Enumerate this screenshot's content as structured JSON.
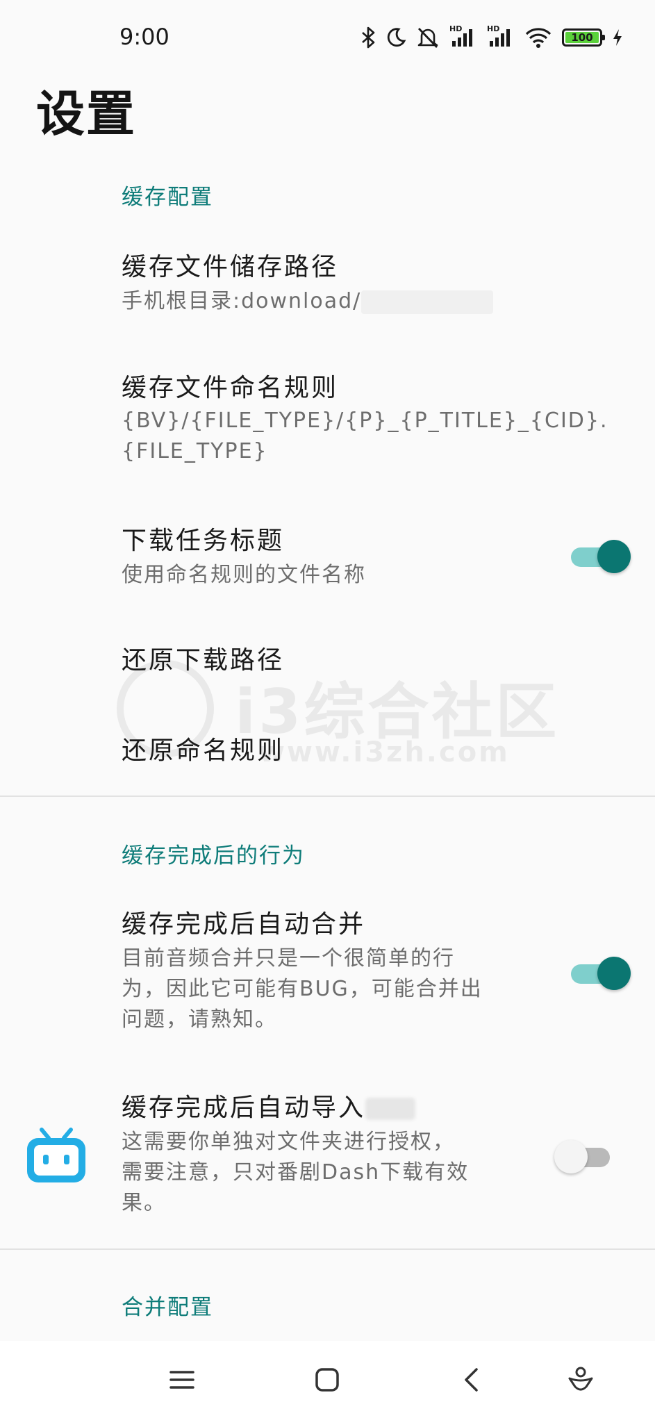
{
  "status_bar": {
    "time": "9:00",
    "hd1": "HD",
    "hd2": "HD",
    "battery": "100",
    "icons": [
      "bluetooth-icon",
      "moon-icon",
      "mute-icon",
      "signal-icon",
      "signal-icon",
      "wifi-icon",
      "battery-icon",
      "charging-icon"
    ]
  },
  "page": {
    "title": "设置"
  },
  "sections": {
    "cache_config": {
      "header": "缓存配置",
      "path_title": "缓存文件储存路径",
      "path_sub": "手机根目录:download/",
      "naming_title": "缓存文件命名规则",
      "naming_sub_line1": "{BV}/{FILE_TYPE}/{P}_{P_TITLE}_{CID}.",
      "naming_sub_line2": "{FILE_TYPE}",
      "task_title": "下载任务标题",
      "task_sub": "使用命名规则的文件名称",
      "restore_path": "还原下载路径",
      "restore_naming": "还原命名规则"
    },
    "after_cache": {
      "header": "缓存完成后的行为",
      "merge_title": "缓存完成后自动合并",
      "merge_sub_line1": "目前音频合并只是一个很简单的行",
      "merge_sub_line2": "为，因此它可能有BUG，可能合并出",
      "merge_sub_line3": "问题，请熟知。",
      "import_title": "缓存完成后自动导入",
      "import_sub_line1": "这需要你单独对文件夹进行授权，",
      "import_sub_line2": "需要注意，只对番剧Dash下载有效",
      "import_sub_line3": "果。"
    },
    "merge_config": {
      "header": "合并配置"
    }
  },
  "toggles": {
    "task_title": true,
    "auto_merge": true,
    "auto_import": false
  },
  "watermark": {
    "text_big": "i3综合社区",
    "text_small": "www.i3zh.com"
  },
  "nav": {
    "icons": [
      "menu-icon",
      "home-icon",
      "back-icon",
      "assistant-icon"
    ]
  },
  "colors": {
    "accent": "#0b7671",
    "accent_light": "#7fcfcc",
    "section_header": "#0e7c79",
    "bilibili_blue": "#23ade5"
  }
}
